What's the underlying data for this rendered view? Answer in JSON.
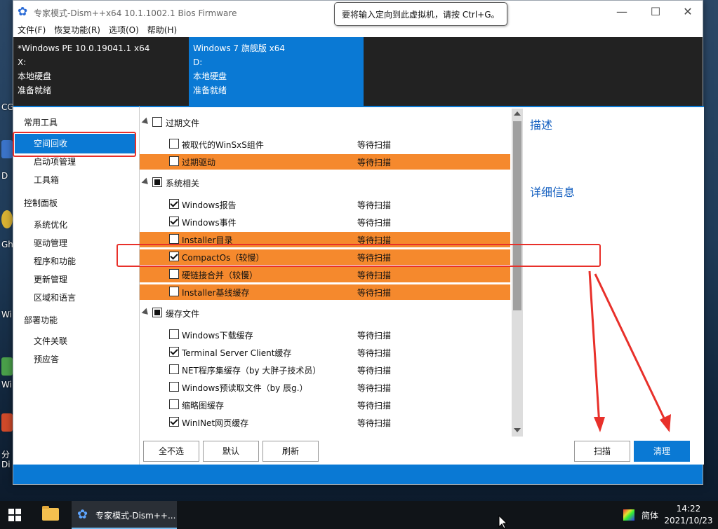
{
  "window": {
    "title": "专家模式-Dism++x64 10.1.1002.1 Bios Firmware",
    "tooltip": "要将输入定向到此虚拟机，请按 Ctrl+G。",
    "controls": {
      "minimize": "—",
      "maximize": "☐",
      "close": "✕"
    }
  },
  "menu": [
    "文件(F)",
    "恢复功能(R)",
    "选项(O)",
    "帮助(H)"
  ],
  "systems": [
    {
      "name": "*Windows PE 10.0.19041.1 x64",
      "drive": "X:",
      "disk": "本地硬盘",
      "status": "准备就绪"
    },
    {
      "name": "Windows 7 旗舰版 x64",
      "drive": "D:",
      "disk": "本地硬盘",
      "status": "准备就绪"
    }
  ],
  "sidebar": {
    "categories": [
      "常用工具",
      "控制面板",
      "部署功能"
    ],
    "common": [
      "空间回收",
      "启动项管理",
      "工具箱"
    ],
    "control": [
      "系统优化",
      "驱动管理",
      "程序和功能",
      "更新管理",
      "区域和语言"
    ],
    "deploy": [
      "文件关联",
      "预应答"
    ]
  },
  "list": {
    "groups": [
      "过期文件",
      "系统相关",
      "缓存文件"
    ],
    "items": [
      {
        "name": "被取代的WinSxS组件",
        "status": "等待扫描"
      },
      {
        "name": "过期驱动",
        "status": "等待扫描"
      },
      {
        "name": "Windows报告",
        "status": "等待扫描"
      },
      {
        "name": "Windows事件",
        "status": "等待扫描"
      },
      {
        "name": "Installer目录",
        "status": "等待扫描"
      },
      {
        "name": "CompactOs（较慢）",
        "status": "等待扫描"
      },
      {
        "name": "硬链接合并（较慢）",
        "status": "等待扫描"
      },
      {
        "name": "Installer基线缓存",
        "status": "等待扫描"
      },
      {
        "name": "Windows下载缓存",
        "status": "等待扫描"
      },
      {
        "name": "Terminal Server Client缓存",
        "status": "等待扫描"
      },
      {
        "name": "NET程序集缓存（by 大胖子技术员）",
        "status": "等待扫描"
      },
      {
        "name": "Windows预读取文件（by 辰g.）",
        "status": "等待扫描"
      },
      {
        "name": "缩略图缓存",
        "status": "等待扫描"
      },
      {
        "name": "WinINet网页缓存",
        "status": "等待扫描"
      }
    ]
  },
  "description": {
    "title": "描述",
    "details": "详细信息"
  },
  "buttons": {
    "deselect_all": "全不选",
    "default": "默认",
    "refresh": "刷新",
    "scan": "扫描",
    "clean": "清理"
  },
  "taskbar": {
    "app_label": "专家模式-Dism++...",
    "ime": "简体",
    "time": "14:22",
    "date": "2021/10/23"
  },
  "desktop_labels": [
    "CG",
    "D",
    "Gh",
    "Wi",
    "Wi",
    "分",
    "Di"
  ]
}
